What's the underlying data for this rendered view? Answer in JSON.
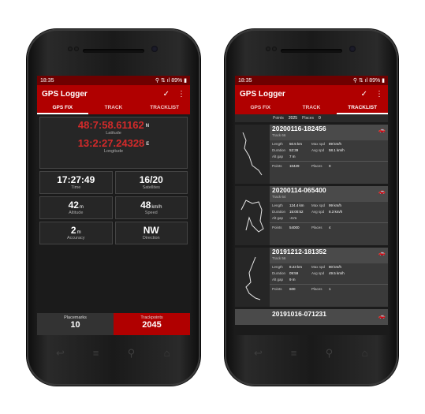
{
  "status": {
    "time": "18:35",
    "icons": "⚲ ⇅ ıl",
    "battery": "89%"
  },
  "app": {
    "title": "GPS Logger",
    "check": "✓",
    "menu": "⋮"
  },
  "tabs": [
    "GPS FIX",
    "TRACK",
    "TRACKLIST"
  ],
  "fix": {
    "latitude_value": "48:7:58.61162",
    "latitude_dir": "N",
    "latitude_label": "Latitude",
    "longitude_value": "13:2:27.24328",
    "longitude_dir": "E",
    "longitude_label": "Longitude",
    "time": {
      "value": "17:27:49",
      "label": "Time"
    },
    "satellites": {
      "value": "16/20",
      "label": "Satellites"
    },
    "altitude": {
      "value": "42",
      "unit": "m",
      "label": "Altitude"
    },
    "speed": {
      "value": "48",
      "unit": "km/h",
      "label": "Speed"
    },
    "accuracy": {
      "value": "2",
      "unit": "m",
      "label": "Accuracy"
    },
    "direction": {
      "value": "NW",
      "label": "Direction"
    },
    "placemarks": {
      "label": "Placemarks",
      "value": "10"
    },
    "trackpoints": {
      "label": "Trackpoints",
      "value": "2045"
    }
  },
  "tracklist": {
    "partial": {
      "points_label": "Points",
      "points": "2025",
      "places_label": "Places",
      "places": "0"
    },
    "labels": {
      "length": "Length",
      "duration": "Duration",
      "altgap": "Alt gap",
      "maxspd": "Max spd",
      "avgspd": "Avg spd",
      "points": "Points",
      "places": "Places"
    },
    "tracks": [
      {
        "name": "20200116-182456",
        "sub": "Track 66",
        "length": "50.5 km",
        "duration": "52:39",
        "altgap": "7 m",
        "maxspd": "89 km/h",
        "avgspd": "58.1 km/h",
        "points": "10429",
        "places": "0"
      },
      {
        "name": "20200114-065400",
        "sub": "Track 64",
        "length": "124.4 km",
        "duration": "15:00:52",
        "altgap": "-4 m",
        "maxspd": "99 km/h",
        "avgspd": "8.3 km/h",
        "points": "54000",
        "places": "4"
      },
      {
        "name": "20191212-181352",
        "sub": "Track 56",
        "length": "8.23 km",
        "duration": "09:59",
        "altgap": "9 m",
        "maxspd": "80 km/h",
        "avgspd": "49.5 km/h",
        "points": "600",
        "places": "1"
      }
    ],
    "peek": "20191016-071231"
  },
  "icons": {
    "car": "car-icon",
    "back": "back-icon",
    "menu": "menu-icon",
    "search": "search-icon",
    "home": "home-icon"
  }
}
